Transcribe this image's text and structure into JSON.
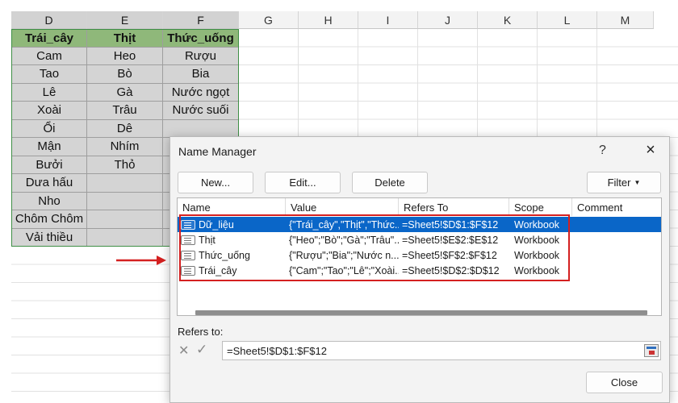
{
  "sheet": {
    "columns": [
      "D",
      "E",
      "F",
      "G",
      "H",
      "I",
      "J",
      "K",
      "L",
      "M"
    ],
    "table": {
      "headers": [
        "Trái_cây",
        "Thịt",
        "Thức_uống"
      ],
      "rows": [
        [
          "Cam",
          "Heo",
          "Rượu"
        ],
        [
          "Tao",
          "Bò",
          "Bia"
        ],
        [
          "Lê",
          "Gà",
          "Nước ngọt"
        ],
        [
          "Xoài",
          "Trâu",
          "Nước suối"
        ],
        [
          "Ổi",
          "Dê",
          ""
        ],
        [
          "Mận",
          "Nhím",
          ""
        ],
        [
          "Bưởi",
          "Thỏ",
          ""
        ],
        [
          "Dưa hấu",
          "",
          ""
        ],
        [
          "Nho",
          "",
          ""
        ],
        [
          "Chôm Chôm",
          "",
          ""
        ],
        [
          "Vải thiều",
          "",
          ""
        ]
      ]
    }
  },
  "dialog": {
    "title": "Name Manager",
    "help": "?",
    "close_icon": "×",
    "buttons": {
      "new": "New...",
      "edit": "Edit...",
      "delete": "Delete",
      "filter": "Filter",
      "close": "Close"
    },
    "columns": [
      "Name",
      "Value",
      "Refers To",
      "Scope",
      "Comment"
    ],
    "names": [
      {
        "name": "Dữ_liệu",
        "value": "{\"Trái_cây\",\"Thịt\",\"Thức...",
        "refers_to": "=Sheet5!$D$1:$F$12",
        "scope": "Workbook",
        "comment": "",
        "selected": true
      },
      {
        "name": "Thịt",
        "value": "{\"Heo\";\"Bò\";\"Gà\";\"Trâu\"...",
        "refers_to": "=Sheet5!$E$2:$E$12",
        "scope": "Workbook",
        "comment": "",
        "selected": false
      },
      {
        "name": "Thức_uống",
        "value": "{\"Rượu\";\"Bia\";\"Nước n...",
        "refers_to": "=Sheet5!$F$2:$F$12",
        "scope": "Workbook",
        "comment": "",
        "selected": false
      },
      {
        "name": "Trái_cây",
        "value": "{\"Cam\";\"Tao\";\"Lê\";\"Xoài...",
        "refers_to": "=Sheet5!$D$2:$D$12",
        "scope": "Workbook",
        "comment": "",
        "selected": false
      }
    ],
    "refers_to_label": "Refers to:",
    "refers_to_value": "=Sheet5!$D$1:$F$12",
    "cancel_icon": "✕",
    "confirm_icon": "✓"
  },
  "colors": {
    "header_fill": "#8fb87a",
    "body_fill": "#d4d4d4",
    "selection_blue": "#0a66c8",
    "highlight_red": "#d42020"
  }
}
